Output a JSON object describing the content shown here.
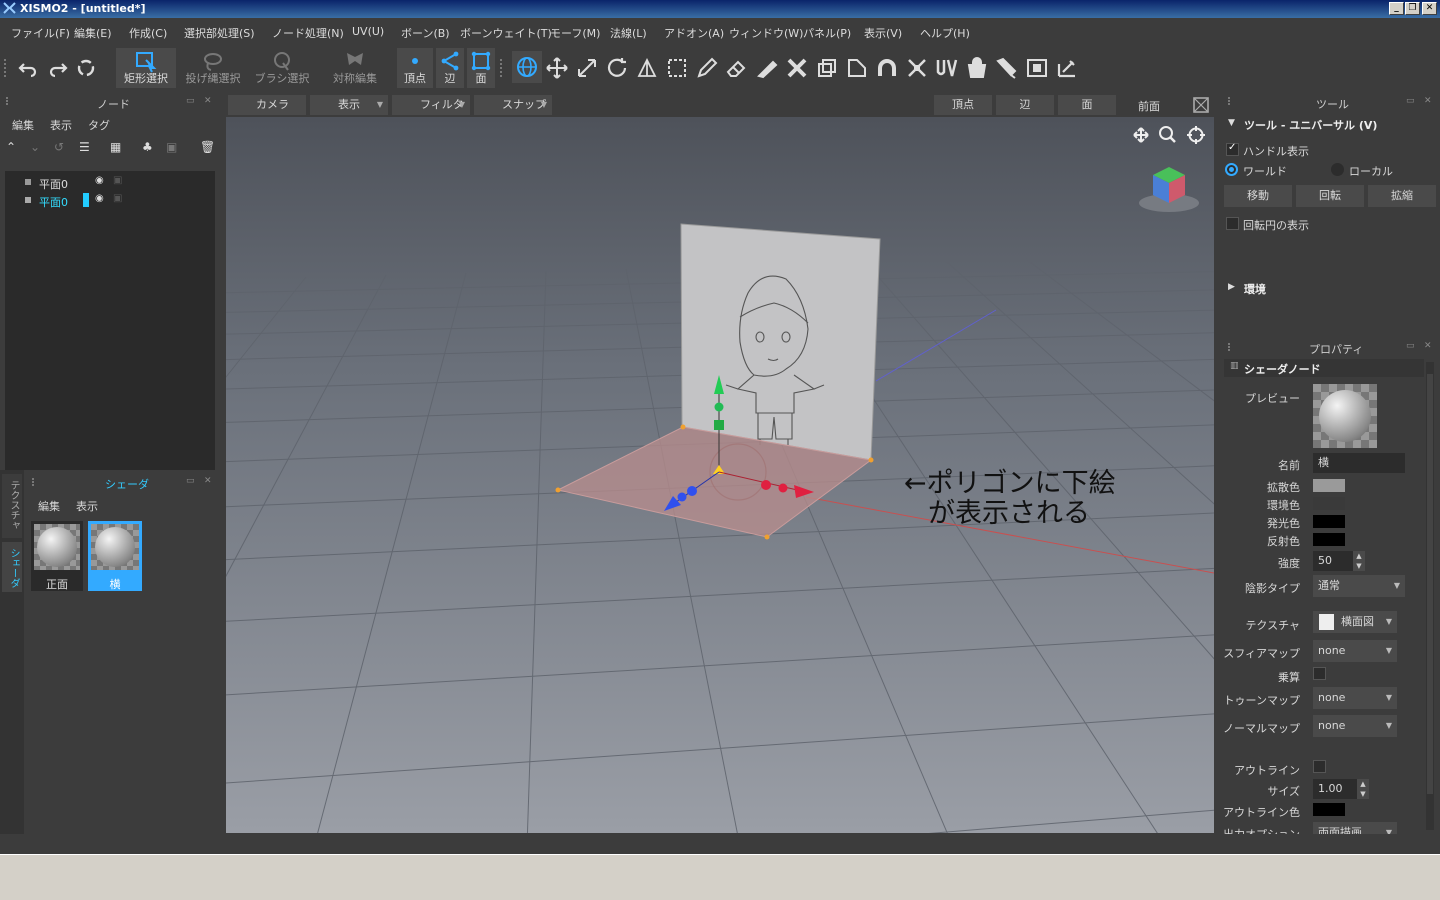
{
  "window": {
    "title": "XISMO2 - [untitled*]"
  },
  "menu": [
    "ファイル(F)",
    "編集(E)",
    "作成(C)",
    "選択部処理(S)",
    "ノード処理(N)",
    "UV(U)",
    "ボーン(B)",
    "ボーンウェイト(T)",
    "モーフ(M)",
    "法線(L)",
    "アドオン(A)",
    "ウィンドウ(W)",
    "パネル(P)",
    "表示(V)",
    "ヘルプ(H)"
  ],
  "toolbar": {
    "rect_select": "矩形選択",
    "lasso_select": "投げ縄選択",
    "brush_select": "ブラシ選択",
    "symmetry_edit": "対称編集",
    "vertex": "頂点",
    "edge": "辺",
    "face": "面"
  },
  "node_panel": {
    "title": "ノード",
    "menu": [
      "編集",
      "表示",
      "タグ"
    ],
    "items": [
      {
        "label": "平面0",
        "selected": false
      },
      {
        "label": "平面0",
        "selected": true
      }
    ]
  },
  "shader_panel": {
    "title": "シェーダ",
    "menu": [
      "編集",
      "表示"
    ],
    "items": [
      {
        "label": "正面",
        "selected": false
      },
      {
        "label": "横",
        "selected": true
      }
    ],
    "side_tabs": [
      "テクスチャ",
      "シェーダ"
    ]
  },
  "viewport": {
    "toolbar": {
      "camera": "カメラ",
      "display": "表示",
      "filter": "フィルタ",
      "snap": "スナップ",
      "vertex": "頂点",
      "edge": "辺",
      "face": "面",
      "view_name": "前面"
    },
    "annotation_line1": "←ポリゴンに下絵",
    "annotation_line2": "が表示される"
  },
  "tool_panel": {
    "title": "ツール",
    "section": "ツール - ユニバーサル (V)",
    "show_handle": "ハンドル表示",
    "world": "ワールド",
    "local": "ローカル",
    "move": "移動",
    "rotate": "回転",
    "scale": "拡縮",
    "show_rotation_circle": "回転円の表示",
    "environment": "環境"
  },
  "property_panel": {
    "title": "プロパティ",
    "section": "シェーダノード",
    "preview_label": "プレビュー",
    "name_label": "名前",
    "name_value": "横",
    "diffuse_label": "拡散色",
    "ambient_label": "環境色",
    "emissive_label": "発光色",
    "specular_label": "反射色",
    "strength_label": "強度",
    "strength_value": "50",
    "shading_label": "陰影タイプ",
    "shading_value": "通常",
    "texture_label": "テクスチャ",
    "texture_value": "横面図",
    "spheremap_label": "スフィアマップ",
    "spheremap_value": "none",
    "multiply_label": "乗算",
    "toonmap_label": "トゥーンマップ",
    "toonmap_value": "none",
    "normalmap_label": "ノーマルマップ",
    "normalmap_value": "none",
    "outline_label": "アウトライン",
    "size_label": "サイズ",
    "size_value": "1.00",
    "outline_color_label": "アウトライン色",
    "output_option_label": "出力オプション",
    "output_option_value": "両面描画"
  },
  "colors": {
    "diffuse": "#9a9a9a",
    "ambient": "#3a3a3a",
    "emissive": "#000000",
    "specular": "#000000",
    "outline": "#000000",
    "accent": "#33aaff"
  }
}
